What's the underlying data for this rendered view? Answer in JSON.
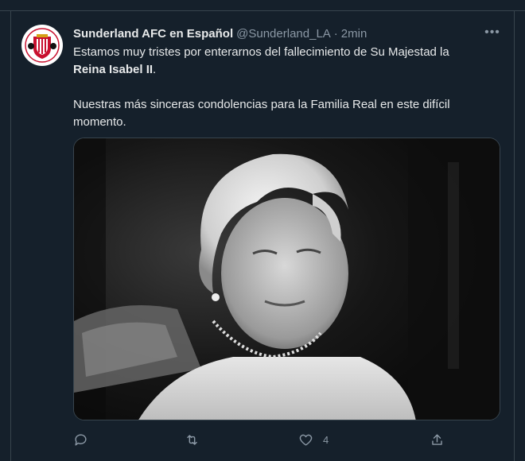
{
  "tweet": {
    "display_name": "Sunderland AFC en Español",
    "handle": "@Sunderland_LA",
    "separator": "·",
    "time": "2min",
    "more_label": "•••",
    "text": {
      "line1": "Estamos muy tristes por enterarnos del fallecimiento de Su Majestad la",
      "line2_bold": "Reina Isabel II",
      "line2_suffix": ".",
      "para2": "Nuestras más sinceras condolencias para la Familia Real en este difícil momento."
    },
    "media": {
      "icon": "photo"
    },
    "actions": {
      "reply_icon": "reply-icon",
      "retweet_icon": "retweet-icon",
      "like_icon": "like-icon",
      "like_count": "4",
      "share_icon": "share-icon"
    }
  },
  "colors": {
    "background": "#15202b",
    "text": "#e7e9ea",
    "muted": "#8b98a5",
    "border": "#38444d"
  }
}
